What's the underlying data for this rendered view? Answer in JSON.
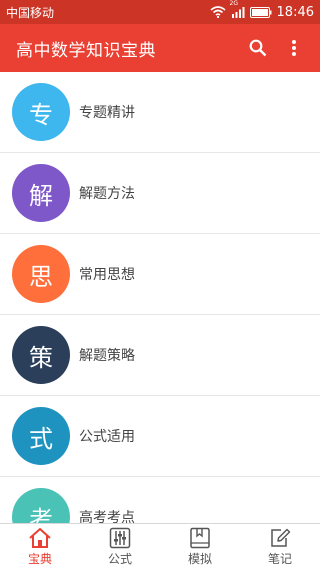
{
  "status_bar": {
    "carrier": "中国移动",
    "network": "2G",
    "time": "18:46"
  },
  "app_bar": {
    "title": "高中数学知识宝典",
    "search_icon": "search-icon",
    "more_icon": "more-vert-icon"
  },
  "colors": {
    "status_bar": "#cc3526",
    "app_bar": "#e94033",
    "accent": "#e94033"
  },
  "list": {
    "items": [
      {
        "char": "专",
        "label": "专题精讲",
        "color": "#3db7ee"
      },
      {
        "char": "解",
        "label": "解题方法",
        "color": "#7e57c9"
      },
      {
        "char": "思",
        "label": "常用思想",
        "color": "#ff6f3c"
      },
      {
        "char": "策",
        "label": "解题策略",
        "color": "#2b3f5a"
      },
      {
        "char": "式",
        "label": "公式适用",
        "color": "#1f93bf"
      },
      {
        "char": "考",
        "label": "高考考点",
        "color": "#4ac2b6"
      }
    ]
  },
  "bottom_nav": {
    "items": [
      {
        "label": "宝典",
        "icon": "home-icon",
        "active": true
      },
      {
        "label": "公式",
        "icon": "sliders-icon",
        "active": false
      },
      {
        "label": "模拟",
        "icon": "book-icon",
        "active": false
      },
      {
        "label": "笔记",
        "icon": "edit-icon",
        "active": false
      }
    ]
  }
}
